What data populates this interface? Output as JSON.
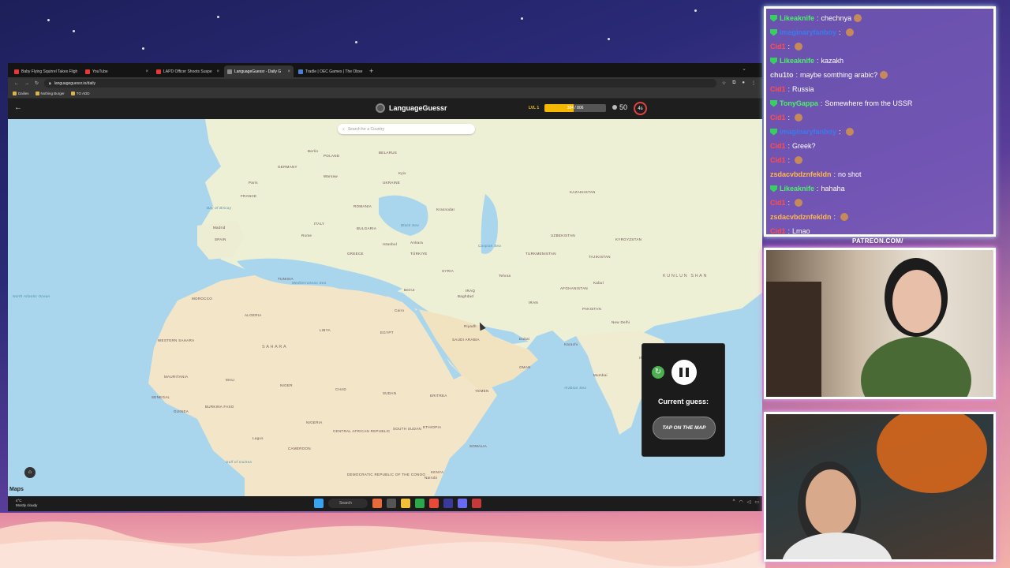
{
  "browser": {
    "tabs": [
      {
        "label": "Baby Flying Squirrel Takes Fligh",
        "fav_color": "#e53935",
        "active": false
      },
      {
        "label": "YouTube",
        "fav_color": "#e53935",
        "active": false
      },
      {
        "label": "LAPD Officer Shoots Suspe",
        "fav_color": "#e53935",
        "active": false
      },
      {
        "label": "LanguageGuessr - Daily G",
        "fav_color": "#888888",
        "active": true
      },
      {
        "label": "Tradle | OEC Games | The Obse",
        "fav_color": "#4a7fd1",
        "active": false
      }
    ],
    "new_tab": "+",
    "url": "languageguessr.io/daily",
    "bookmarks": [
      "Dailies",
      "Nothing Burger",
      "TO ADD"
    ]
  },
  "app": {
    "title": "LanguageGuessr",
    "level": "LVL 1",
    "xp_text": "384 / 806",
    "xp_fraction": 0.476,
    "coins": "50",
    "timer": "4s",
    "search_placeholder": "Search for a Country",
    "current_guess_label": "Current guess:",
    "tap_label": "TAP ON THE MAP",
    "map_provider": "Maps"
  },
  "map_labels": {
    "countries": [
      "POLAND",
      "BELARUS",
      "UKRAINE",
      "GERMANY",
      "FRANCE",
      "SPAIN",
      "ITALY",
      "ROMANIA",
      "BULGARIA",
      "GREECE",
      "TÜRKIYE",
      "SYRIA",
      "IRAQ",
      "IRAN",
      "SAUDI ARABIA",
      "EGYPT",
      "LIBYA",
      "ALGERIA",
      "TUNISIA",
      "MOROCCO",
      "WESTERN SAHARA",
      "MAURITANIA",
      "MALI",
      "NIGER",
      "CHAD",
      "SUDAN",
      "ETHIOPIA",
      "SOMALIA",
      "KENYA",
      "YEMEN",
      "OMAN",
      "AFGHANISTAN",
      "PAKISTAN",
      "TURKMENISTAN",
      "UZBEKISTAN",
      "KAZAKHSTAN",
      "TAJIKISTAN",
      "NIGERIA",
      "CAMEROON",
      "CENTRAL AFRICAN REPUBLIC",
      "DEMOCRATIC REPUBLIC OF THE CONGO",
      "SENEGAL",
      "GUINEA",
      "BURKINA FASO",
      "SOUTH SUDAN",
      "ERITREA",
      "KYRGYZSTAN",
      "INDIA"
    ],
    "cities": [
      "Berlin",
      "Paris",
      "Madrid",
      "Rome",
      "Istanbul",
      "Ankara",
      "Beirut",
      "Cairo",
      "Tehran",
      "Kabul",
      "New Delhi",
      "Karachi",
      "Dubai",
      "Lagos",
      "Nairobi",
      "Riyadh",
      "Baghdad",
      "Kyiv",
      "Warsaw",
      "Krasnodar",
      "Mumbai"
    ],
    "regions": [
      "SAHARA",
      "KUNLUN SHAN"
    ],
    "seas": [
      "North Atlantic Ocean",
      "Mediterranean Sea",
      "Black Sea",
      "Caspian Sea",
      "Arabian Sea",
      "Gulf of Guinea",
      "Bay of Biscay"
    ]
  },
  "taskbar": {
    "weather_temp": "4°C",
    "weather_desc": "Mostly cloudy",
    "search": "Search"
  },
  "chat": [
    {
      "user": "Likeaknife",
      "color": "#4cf06b",
      "mod": true,
      "msg": "chechnya",
      "emote": true
    },
    {
      "user": "imaginaryfanboy",
      "color": "#3a7bf0",
      "mod": true,
      "msg": "",
      "emote": true
    },
    {
      "user": "Cid1",
      "color": "#ff4d4d",
      "mod": false,
      "msg": "",
      "emote": true
    },
    {
      "user": "Likeaknife",
      "color": "#4cf06b",
      "mod": true,
      "msg": "kazakh",
      "emote": false
    },
    {
      "user": "chu1to",
      "color": "#e0e0e0",
      "mod": false,
      "msg": "maybe somthing arabic?",
      "emote": true
    },
    {
      "user": "Cid1",
      "color": "#ff4d4d",
      "mod": false,
      "msg": "Russia",
      "emote": false
    },
    {
      "user": "TonyGappa",
      "color": "#4cf06b",
      "mod": true,
      "msg": "Somewhere from the USSR",
      "emote": false
    },
    {
      "user": "Cid1",
      "color": "#ff4d4d",
      "mod": false,
      "msg": "",
      "emote": true
    },
    {
      "user": "imaginaryfanboy",
      "color": "#3a7bf0",
      "mod": true,
      "msg": "",
      "emote": true
    },
    {
      "user": "Cid1",
      "color": "#ff4d4d",
      "mod": false,
      "msg": "Greek?",
      "emote": false
    },
    {
      "user": "Cid1",
      "color": "#ff4d4d",
      "mod": false,
      "msg": "",
      "emote": true
    },
    {
      "user": "zsdacvbdznfekldn",
      "color": "#ffb84d",
      "mod": false,
      "msg": "no shot",
      "emote": false
    },
    {
      "user": "Likeaknife",
      "color": "#4cf06b",
      "mod": true,
      "msg": "hahaha",
      "emote": false
    },
    {
      "user": "Cid1",
      "color": "#ff4d4d",
      "mod": false,
      "msg": "",
      "emote": true
    },
    {
      "user": "zsdacvbdznfekldn",
      "color": "#ffb84d",
      "mod": false,
      "msg": "",
      "emote": true
    },
    {
      "user": "Cid1",
      "color": "#ff4d4d",
      "mod": false,
      "msg": "Lmao",
      "emote": false
    }
  ],
  "overlay": {
    "patreon": "PATREON.COM/"
  },
  "colors": {
    "accent": "#f5b800",
    "timer_ring": "#e0433d",
    "land": "#f3ead2",
    "water": "#a9d6ec"
  }
}
